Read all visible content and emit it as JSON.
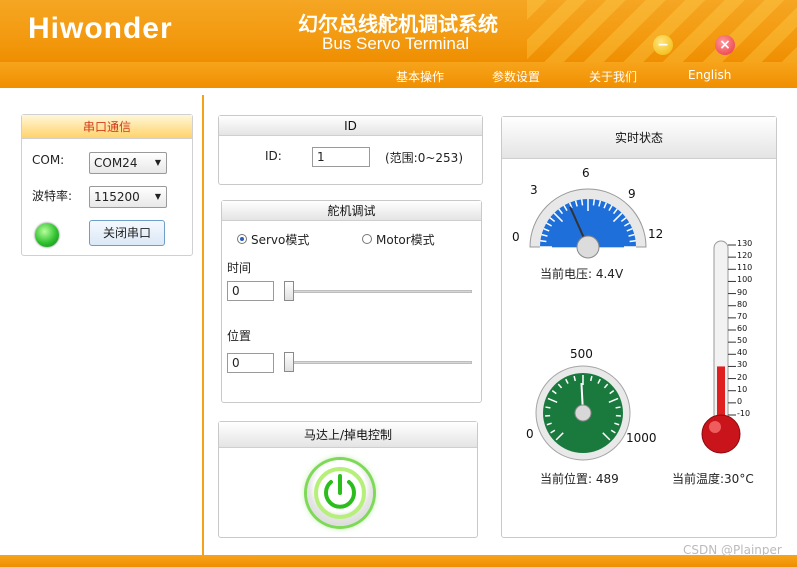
{
  "header": {
    "logo": "Hiwonder",
    "title_cn": "幻尔总线舵机调试系统",
    "title_en": "Bus Servo Terminal",
    "minimize": "−",
    "close": "×"
  },
  "nav": {
    "items": [
      "基本操作",
      "参数设置",
      "关于我们",
      "English"
    ]
  },
  "serial": {
    "title": "串口通信",
    "com_label": "COM:",
    "com_value": "COM24",
    "baud_label": "波特率:",
    "baud_value": "115200",
    "close_button": "关闭串口",
    "led_color": "#2fc12f"
  },
  "id_panel": {
    "title": "ID",
    "id_label": "ID:",
    "id_value": "1",
    "range": "(范围:0~253)"
  },
  "servo_panel": {
    "title": "舵机调试",
    "mode_servo": "Servo模式",
    "mode_motor": "Motor模式",
    "selected_mode": "Servo模式",
    "time_label": "时间",
    "time_value": "0",
    "position_label": "位置",
    "position_value": "0"
  },
  "motor_panel": {
    "title": "马达上/掉电控制",
    "power_color": "#7ed957"
  },
  "status_panel": {
    "title": "实时状态",
    "voltage": {
      "ticks": [
        "0",
        "3",
        "6",
        "9",
        "12"
      ],
      "value": 4.4,
      "label": "当前电压: 4.4V",
      "color": "#1e6fd9"
    },
    "position": {
      "ticks": [
        "0",
        "500",
        "1000"
      ],
      "value": 489,
      "label": "当前位置: 489",
      "color": "#1a7a3e"
    },
    "temperature": {
      "ticks": [
        "130",
        "120",
        "110",
        "100",
        "90",
        "80",
        "70",
        "60",
        "50",
        "40",
        "30",
        "20",
        "10",
        "0",
        "-10"
      ],
      "value": 30,
      "label": "当前温度:30°C",
      "color": "#e02020"
    }
  },
  "watermark": "CSDN @Plainper"
}
